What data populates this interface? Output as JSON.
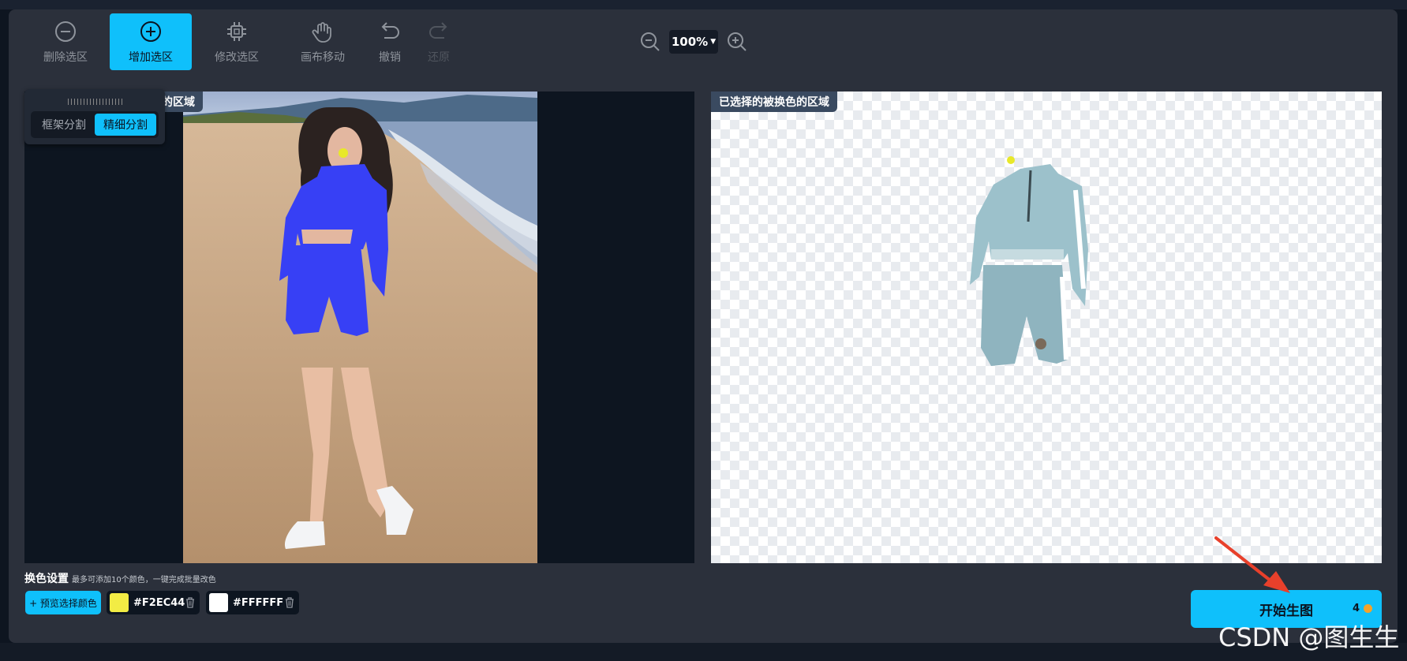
{
  "toolbar": {
    "remove_selection": "删除选区",
    "add_selection": "增加选区",
    "modify_selection": "修改选区",
    "canvas_move": "画布移动",
    "undo": "撤销",
    "redo": "还原"
  },
  "zoom": {
    "value": "100%"
  },
  "segmentation": {
    "frame": "框架分割",
    "fine": "精细分割"
  },
  "left_panel": {
    "label": "的区域"
  },
  "right_panel": {
    "label": "已选择的被换色的区域"
  },
  "color_settings": {
    "title": "换色设置",
    "hint": "最多可添加10个颜色，一键完成批量改色",
    "preview_button": "+ 预览选择颜色",
    "colors": [
      {
        "hex": "#F2EC44",
        "swatch": "#F2EC44"
      },
      {
        "hex": "#FFFFFF",
        "swatch": "#FFFFFF"
      }
    ]
  },
  "start_button": {
    "label": "开始生图",
    "cost": "4"
  },
  "watermark": "CSDN @图生生",
  "colors": {
    "accent": "#0fc0fb",
    "modal_bg": "#2b303b",
    "arrow": "#e8402b"
  }
}
